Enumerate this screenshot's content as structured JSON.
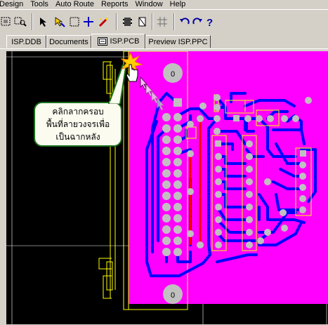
{
  "menu": [
    "Design",
    "Tools",
    "Auto Route",
    "Reports",
    "Window",
    "Help"
  ],
  "toolbar_icons": [
    "zoom-fit-icon",
    "zoom-area-icon",
    "select-icon",
    "move-select-icon",
    "deselect-icon",
    "cross-move-icon",
    "wand-icon",
    "component-icon",
    "component-outline-icon",
    "grid-icon",
    "undo-icon",
    "redo-icon",
    "help-icon"
  ],
  "tabs": [
    {
      "label": "ISP.DDB",
      "active": false
    },
    {
      "label": "Documents",
      "active": false
    },
    {
      "label": "ISP.PCB",
      "active": true
    },
    {
      "label": "Preview ISP.PPC",
      "active": false
    }
  ],
  "callout": {
    "line1": "คลิกลากครอบ",
    "line2": "พื้นที่ลายวงจรเพื่อ",
    "line3": "เป็นฉากหลัง"
  },
  "board": {
    "hole_label_top": "0",
    "hole_label_bottom": "0"
  },
  "colors": {
    "board": "#ff00ff",
    "track_bottom": "#0000ff",
    "track_top": "#ff0000",
    "overlay": "#ffff00",
    "pad": "#c0c0c0",
    "background": "#000000",
    "callout_border": "#1a6e1a"
  }
}
